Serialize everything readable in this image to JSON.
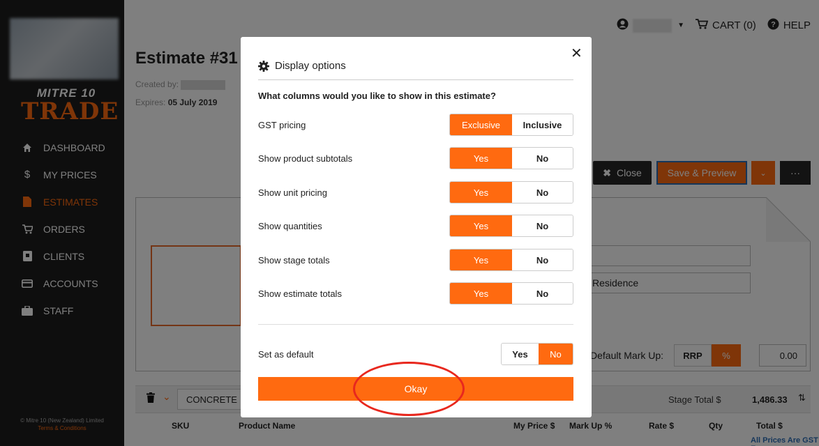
{
  "sidebar": {
    "brand_top": "MITRE 10",
    "brand_bottom": "TRADE",
    "items": [
      {
        "label": "DASHBOARD",
        "icon": "home-icon"
      },
      {
        "label": "MY PRICES",
        "icon": "dollar-icon"
      },
      {
        "label": "ESTIMATES",
        "icon": "document-icon",
        "active": true
      },
      {
        "label": "ORDERS",
        "icon": "cart-icon"
      },
      {
        "label": "CLIENTS",
        "icon": "contact-book-icon"
      },
      {
        "label": "ACCOUNTS",
        "icon": "credit-card-icon"
      },
      {
        "label": "STAFF",
        "icon": "briefcase-icon"
      }
    ],
    "footer_copy": "© Mitre 10 (New Zealand) Limited",
    "footer_link": "Terms & Conditions"
  },
  "topbar": {
    "cart": "CART (0)",
    "help": "HELP"
  },
  "estimate": {
    "title": "Estimate #31",
    "created_label": "Created by:",
    "expires_label": "Expires:",
    "expires_value": "05 July 2019",
    "close_btn": "Close",
    "save_btn": "Save & Preview",
    "more_btn": "···",
    "residence": "Residence",
    "default_markup_label": "Default Mark Up:",
    "markup_rrp": "RRP",
    "markup_pct": "%",
    "markup_value": "0.00",
    "stage_name": "CONCRETE",
    "stage_total_label": "Stage Total $",
    "stage_total_value": "1,486.33",
    "columns": [
      "SKU",
      "Product Name",
      "My Price $",
      "Mark Up %",
      "Rate $",
      "Qty",
      "Total $"
    ],
    "gst_note": "All Prices Are GST Exc"
  },
  "modal": {
    "title": "Display options",
    "question": "What columns would you like to show in this estimate?",
    "options": [
      {
        "label": "GST pricing",
        "a": "Exclusive",
        "b": "Inclusive",
        "selected": "a"
      },
      {
        "label": "Show product subtotals",
        "a": "Yes",
        "b": "No",
        "selected": "a"
      },
      {
        "label": "Show unit pricing",
        "a": "Yes",
        "b": "No",
        "selected": "a"
      },
      {
        "label": "Show quantities",
        "a": "Yes",
        "b": "No",
        "selected": "a"
      },
      {
        "label": "Show stage totals",
        "a": "Yes",
        "b": "No",
        "selected": "a"
      },
      {
        "label": "Show estimate totals",
        "a": "Yes",
        "b": "No",
        "selected": "a"
      }
    ],
    "default_label": "Set as default",
    "default_yes": "Yes",
    "default_no": "No",
    "default_selected": "No",
    "okay": "Okay"
  },
  "colors": {
    "accent": "#ff6a10",
    "sidebar_bg": "#1c1c1c",
    "annotation_ring": "#e8281e"
  }
}
